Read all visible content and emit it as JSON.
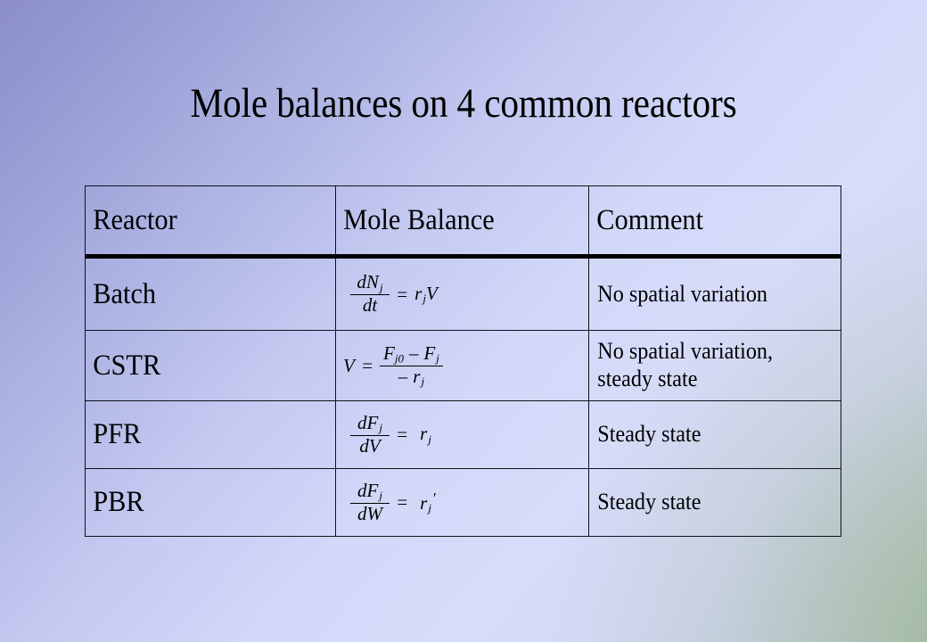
{
  "slide": {
    "title": "Mole balances on 4 common reactors",
    "background": {
      "top_left_color": "#8b8ecb",
      "top_right_color": "#d5daf8",
      "bottom_left_color": "#ccd4f5",
      "bottom_right_color": "#a8bca0"
    },
    "text_color": "#000000",
    "border_color": "#11131c"
  },
  "table": {
    "headers": [
      "Reactor",
      "Mole Balance",
      "Comment"
    ],
    "rows": [
      {
        "reactor": "Batch",
        "equation": {
          "lhs_numerator": "dN",
          "lhs_numerator_sub": "j",
          "lhs_denominator": "dt",
          "operator": "=",
          "rhs": "r",
          "rhs_sub": "j",
          "rhs_tail": "V",
          "plain": "dN_j/dt = r_j V"
        },
        "comment_lines": [
          "No spatial variation"
        ]
      },
      {
        "reactor": "CSTR",
        "equation": {
          "lhs": "V",
          "operator": "=",
          "numerator_first": "F",
          "numerator_first_sub": "j0",
          "numerator_minus": "–",
          "numerator_second": "F",
          "numerator_second_sub": "j",
          "denominator_minus": "–",
          "denominator": "r",
          "denominator_sub": "j",
          "plain": "V = ( F_j0 – F_j ) / ( – r_j )"
        },
        "comment_lines": [
          "No spatial variation,",
          "steady state"
        ]
      },
      {
        "reactor": "PFR",
        "equation": {
          "lhs_numerator": "dF",
          "lhs_numerator_sub": "j",
          "lhs_denominator": "dV",
          "operator": "=",
          "rhs": "r",
          "rhs_sub": "j",
          "rhs_tail": "",
          "plain": "dF_j/dV = r_j"
        },
        "comment_lines": [
          "Steady state"
        ]
      },
      {
        "reactor": "PBR",
        "equation": {
          "lhs_numerator": "dF",
          "lhs_numerator_sub": "j",
          "lhs_denominator": "dW",
          "operator": "=",
          "rhs": "r",
          "rhs_sub": "j",
          "rhs_prime": "′",
          "plain": "dF_j/dW = r'_j"
        },
        "comment_lines": [
          "Steady state"
        ]
      }
    ]
  }
}
